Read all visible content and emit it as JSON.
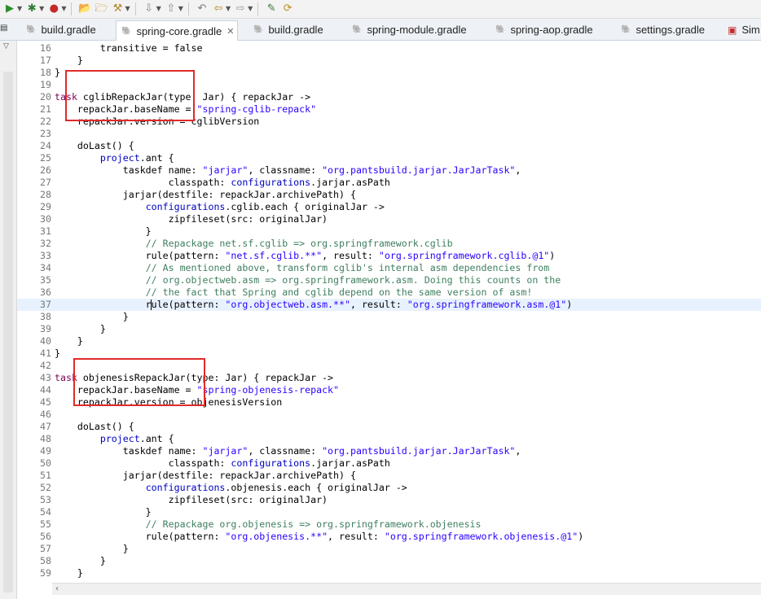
{
  "toolbar": {
    "items": [
      {
        "icon": "run-icon",
        "glyph": "▶",
        "color": "#2a8f2a",
        "dropdown": true
      },
      {
        "icon": "debug-icon",
        "glyph": "✱",
        "color": "#2e7d32",
        "dropdown": true
      },
      {
        "icon": "external-tools-icon",
        "glyph": "●",
        "color": "#c62828",
        "dropdown": true
      },
      {
        "icon": "open-folder-icon",
        "glyph": "📂",
        "color": "#c08a2a",
        "dropdown": false
      },
      {
        "icon": "open-project-icon",
        "glyph": "🗁",
        "color": "#c08a2a",
        "dropdown": false
      },
      {
        "icon": "tools-icon",
        "glyph": "⚒",
        "color": "#b08a30",
        "dropdown": true
      },
      {
        "icon": "next-annotation-icon",
        "glyph": "⇩",
        "color": "#8a8a8a",
        "dropdown": true
      },
      {
        "icon": "prev-annotation-icon",
        "glyph": "⇧",
        "color": "#8a8a8a",
        "dropdown": true
      },
      {
        "icon": "last-edit-icon",
        "glyph": "↶",
        "color": "#7a7a7a",
        "dropdown": false
      },
      {
        "icon": "back-icon",
        "glyph": "⇦",
        "color": "#b0892a",
        "dropdown": true
      },
      {
        "icon": "forward-icon",
        "glyph": "⇨",
        "color": "#9a9a9a",
        "dropdown": true
      },
      {
        "icon": "pin-editor-icon",
        "glyph": "✎",
        "color": "#3a7a3a",
        "dropdown": false
      },
      {
        "icon": "sync-icon",
        "glyph": "⟳",
        "color": "#c0901a",
        "dropdown": false
      }
    ]
  },
  "tabs": [
    {
      "label": "build.gradle",
      "active": false,
      "closable": false
    },
    {
      "label": "spring-core.gradle",
      "active": true,
      "closable": true
    },
    {
      "label": "build.gradle",
      "active": false,
      "closable": false
    },
    {
      "label": "spring-module.gradle",
      "active": false,
      "closable": false
    },
    {
      "label": "spring-aop.gradle",
      "active": false,
      "closable": false
    },
    {
      "label": "settings.gradle",
      "active": false,
      "closable": false
    },
    {
      "label": "Sim",
      "active": false,
      "closable": false
    }
  ],
  "editor": {
    "current_line": 37,
    "lines": [
      {
        "n": "16",
        "t": [
          [
            "        transitive = false",
            ""
          ]
        ]
      },
      {
        "n": "17",
        "t": [
          [
            "    }",
            ""
          ]
        ]
      },
      {
        "n": "18",
        "t": [
          [
            "}",
            ""
          ]
        ]
      },
      {
        "n": "19",
        "t": []
      },
      {
        "n": "20",
        "t": [
          [
            "task",
            "kw"
          ],
          [
            " cglibRepackJar(type: Jar) { repackJar ->",
            ""
          ]
        ]
      },
      {
        "n": "21",
        "t": [
          [
            "    repackJar.baseName = ",
            ""
          ],
          [
            "\"spring-cglib-repack\"",
            "str"
          ]
        ]
      },
      {
        "n": "22",
        "t": [
          [
            "    repackJar.version = cglibVersion",
            ""
          ]
        ]
      },
      {
        "n": "23",
        "t": []
      },
      {
        "n": "24",
        "t": [
          [
            "    doLast() {",
            ""
          ]
        ]
      },
      {
        "n": "25",
        "t": [
          [
            "        ",
            ""
          ],
          [
            "project",
            "pv"
          ],
          [
            ".ant {",
            ""
          ]
        ]
      },
      {
        "n": "26",
        "t": [
          [
            "            taskdef name: ",
            ""
          ],
          [
            "\"jarjar\"",
            "str"
          ],
          [
            ", classname: ",
            ""
          ],
          [
            "\"org.pantsbuild.jarjar.JarJarTask\"",
            "str"
          ],
          [
            ",",
            ""
          ]
        ]
      },
      {
        "n": "27",
        "t": [
          [
            "                    classpath: ",
            ""
          ],
          [
            "configurations",
            "pv"
          ],
          [
            ".jarjar.asPath",
            ""
          ]
        ]
      },
      {
        "n": "28",
        "t": [
          [
            "            jarjar(destfile: repackJar.archivePath) {",
            ""
          ]
        ]
      },
      {
        "n": "29",
        "t": [
          [
            "                ",
            ""
          ],
          [
            "configurations",
            "pv"
          ],
          [
            ".cglib.each { originalJar ->",
            ""
          ]
        ]
      },
      {
        "n": "30",
        "t": [
          [
            "                    zipfileset(src: originalJar)",
            ""
          ]
        ]
      },
      {
        "n": "31",
        "t": [
          [
            "                }",
            ""
          ]
        ]
      },
      {
        "n": "32",
        "t": [
          [
            "                ",
            ""
          ],
          [
            "// Repackage net.sf.cglib => org.springframework.cglib",
            "cm"
          ]
        ]
      },
      {
        "n": "33",
        "t": [
          [
            "                rule(pattern: ",
            ""
          ],
          [
            "\"net.sf.cglib.**\"",
            "str"
          ],
          [
            ", result: ",
            ""
          ],
          [
            "\"org.springframework.cglib.@1\"",
            "str"
          ],
          [
            ")",
            ""
          ]
        ]
      },
      {
        "n": "34",
        "t": [
          [
            "                ",
            ""
          ],
          [
            "// As mentioned above, transform cglib's internal asm dependencies from",
            "cm"
          ]
        ]
      },
      {
        "n": "35",
        "t": [
          [
            "                ",
            ""
          ],
          [
            "// org.objectweb.asm => org.springframework.asm. Doing this counts on the",
            "cm"
          ]
        ]
      },
      {
        "n": "36",
        "t": [
          [
            "                ",
            ""
          ],
          [
            "// the fact that Spring and cglib depend on the same version of asm!",
            "cm"
          ]
        ]
      },
      {
        "n": "37",
        "t": [
          [
            "                r",
            ""
          ],
          [
            "|",
            "cursor"
          ],
          [
            "ule(pattern: ",
            ""
          ],
          [
            "\"org.objectweb.asm.**\"",
            "str"
          ],
          [
            ", result: ",
            ""
          ],
          [
            "\"org.springframework.asm.@1\"",
            "str"
          ],
          [
            ")",
            ""
          ]
        ]
      },
      {
        "n": "38",
        "t": [
          [
            "            }",
            ""
          ]
        ]
      },
      {
        "n": "39",
        "t": [
          [
            "        }",
            ""
          ]
        ]
      },
      {
        "n": "40",
        "t": [
          [
            "    }",
            ""
          ]
        ]
      },
      {
        "n": "41",
        "t": [
          [
            "}",
            ""
          ]
        ]
      },
      {
        "n": "42",
        "t": []
      },
      {
        "n": "43",
        "t": [
          [
            "task",
            "kw"
          ],
          [
            " objenesisRepackJar(type: Jar) { repackJar ->",
            ""
          ]
        ]
      },
      {
        "n": "44",
        "t": [
          [
            "    repackJar.baseName = ",
            ""
          ],
          [
            "\"spring-objenesis-repack\"",
            "str"
          ]
        ]
      },
      {
        "n": "45",
        "t": [
          [
            "    repackJar.version = objenesisVersion",
            ""
          ]
        ]
      },
      {
        "n": "46",
        "t": []
      },
      {
        "n": "47",
        "t": [
          [
            "    doLast() {",
            ""
          ]
        ]
      },
      {
        "n": "48",
        "t": [
          [
            "        ",
            ""
          ],
          [
            "project",
            "pv"
          ],
          [
            ".ant {",
            ""
          ]
        ]
      },
      {
        "n": "49",
        "t": [
          [
            "            taskdef name: ",
            ""
          ],
          [
            "\"jarjar\"",
            "str"
          ],
          [
            ", classname: ",
            ""
          ],
          [
            "\"org.pantsbuild.jarjar.JarJarTask\"",
            "str"
          ],
          [
            ",",
            ""
          ]
        ]
      },
      {
        "n": "50",
        "t": [
          [
            "                    classpath: ",
            ""
          ],
          [
            "configurations",
            "pv"
          ],
          [
            ".jarjar.asPath",
            ""
          ]
        ]
      },
      {
        "n": "51",
        "t": [
          [
            "            jarjar(destfile: repackJar.archivePath) {",
            ""
          ]
        ]
      },
      {
        "n": "52",
        "t": [
          [
            "                ",
            ""
          ],
          [
            "configurations",
            "pv"
          ],
          [
            ".objenesis.each { originalJar ->",
            ""
          ]
        ]
      },
      {
        "n": "53",
        "t": [
          [
            "                    zipfileset(src: originalJar)",
            ""
          ]
        ]
      },
      {
        "n": "54",
        "t": [
          [
            "                }",
            ""
          ]
        ]
      },
      {
        "n": "55",
        "t": [
          [
            "                ",
            ""
          ],
          [
            "// Repackage org.objenesis => org.springframework.objenesis",
            "cm"
          ]
        ]
      },
      {
        "n": "56",
        "t": [
          [
            "                rule(pattern: ",
            ""
          ],
          [
            "\"org.objenesis.**\"",
            "str"
          ],
          [
            ", result: ",
            ""
          ],
          [
            "\"org.springframework.objenesis.@1\"",
            "str"
          ],
          [
            ")",
            ""
          ]
        ]
      },
      {
        "n": "57",
        "t": [
          [
            "            }",
            ""
          ]
        ]
      },
      {
        "n": "58",
        "t": [
          [
            "        }",
            ""
          ]
        ]
      },
      {
        "n": "59",
        "t": [
          [
            "    }",
            ""
          ]
        ]
      }
    ]
  },
  "colors": {
    "keyword": "#7f0055",
    "string": "#2a00ff",
    "comment": "#3f7f5f",
    "property": "#0000c0",
    "annotation_box": "#e12a2a",
    "current_line": "#e8f2fe"
  }
}
